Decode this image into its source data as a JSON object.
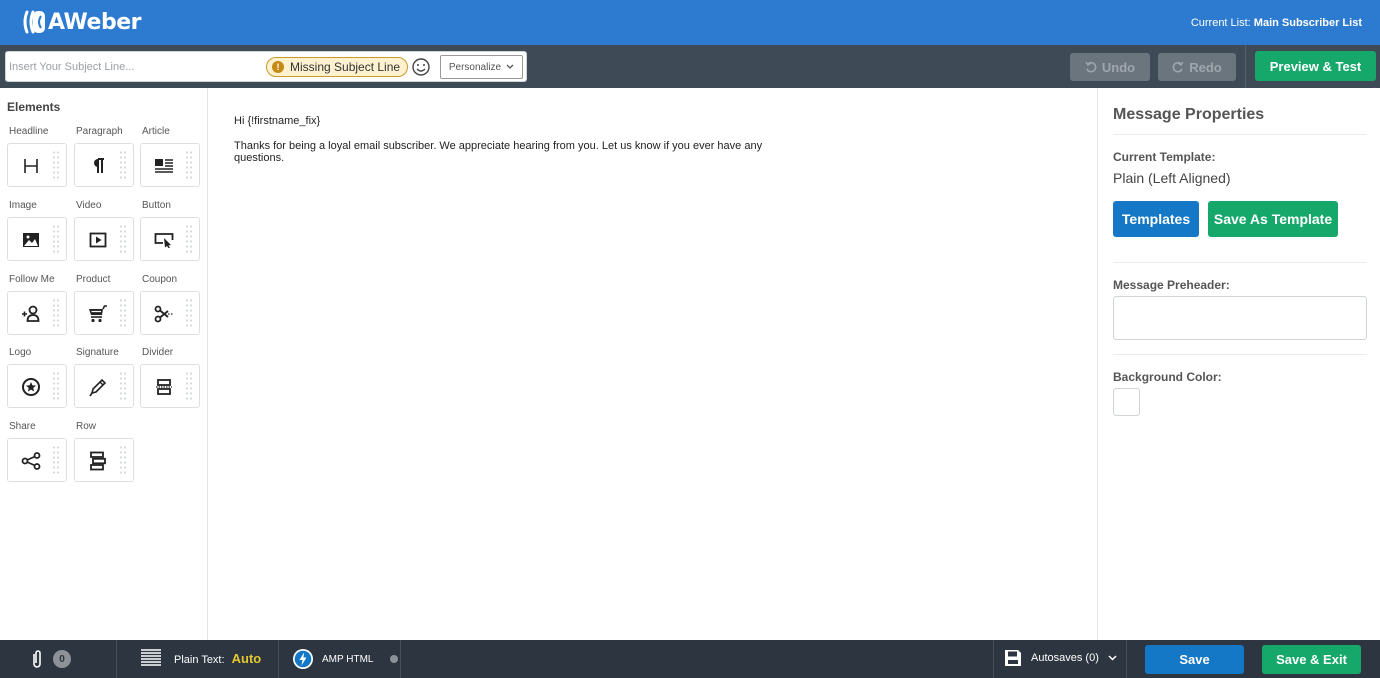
{
  "header": {
    "logo_text": "AWeber",
    "current_list_label": "Current List:",
    "current_list_value": "Main Subscriber List"
  },
  "toolbar": {
    "subject_placeholder": "Insert Your Subject Line...",
    "subject_value": "",
    "missing_badge": "Missing Subject Line",
    "personalize_label": "Personalize",
    "undo_label": "Undo",
    "redo_label": "Redo",
    "preview_label": "Preview & Test"
  },
  "sidebar": {
    "title": "Elements",
    "items": [
      {
        "label": "Headline",
        "icon": "headline-icon"
      },
      {
        "label": "Paragraph",
        "icon": "paragraph-icon"
      },
      {
        "label": "Article",
        "icon": "article-icon"
      },
      {
        "label": "Image",
        "icon": "image-icon"
      },
      {
        "label": "Video",
        "icon": "video-icon"
      },
      {
        "label": "Button",
        "icon": "button-icon"
      },
      {
        "label": "Follow Me",
        "icon": "follow-me-icon"
      },
      {
        "label": "Product",
        "icon": "cart-icon"
      },
      {
        "label": "Coupon",
        "icon": "scissors-icon"
      },
      {
        "label": "Logo",
        "icon": "star-circle-icon"
      },
      {
        "label": "Signature",
        "icon": "pen-icon"
      },
      {
        "label": "Divider",
        "icon": "divider-icon"
      },
      {
        "label": "Share",
        "icon": "share-icon"
      },
      {
        "label": "Row",
        "icon": "row-icon"
      }
    ]
  },
  "canvas": {
    "greeting": "Hi {!firstname_fix}",
    "body": "Thanks for being a loyal email subscriber. We appreciate hearing from you. Let us know if you ever have any questions."
  },
  "properties": {
    "title": "Message Properties",
    "current_template_label": "Current Template:",
    "current_template_value": "Plain (Left Aligned)",
    "templates_button": "Templates",
    "save_as_template_button": "Save As Template",
    "preheader_label": "Message Preheader:",
    "preheader_value": "",
    "background_color_label": "Background Color:",
    "background_color_value": "#ffffff"
  },
  "footer": {
    "attachments_count": "0",
    "plain_text_label": "Plain Text:",
    "plain_text_value": "Auto",
    "amp_label": "AMP HTML",
    "autosaves_label": "Autosaves (0)",
    "save_label": "Save",
    "save_exit_label": "Save & Exit"
  },
  "colors": {
    "brand_blue": "#2d7bd1",
    "primary_button": "#1478c6",
    "success_green": "#16a86b",
    "toolbar_bg": "#3e4a55",
    "footer_bg": "#2d3640",
    "warning": "#c48a14",
    "auto_yellow": "#e3c730"
  }
}
